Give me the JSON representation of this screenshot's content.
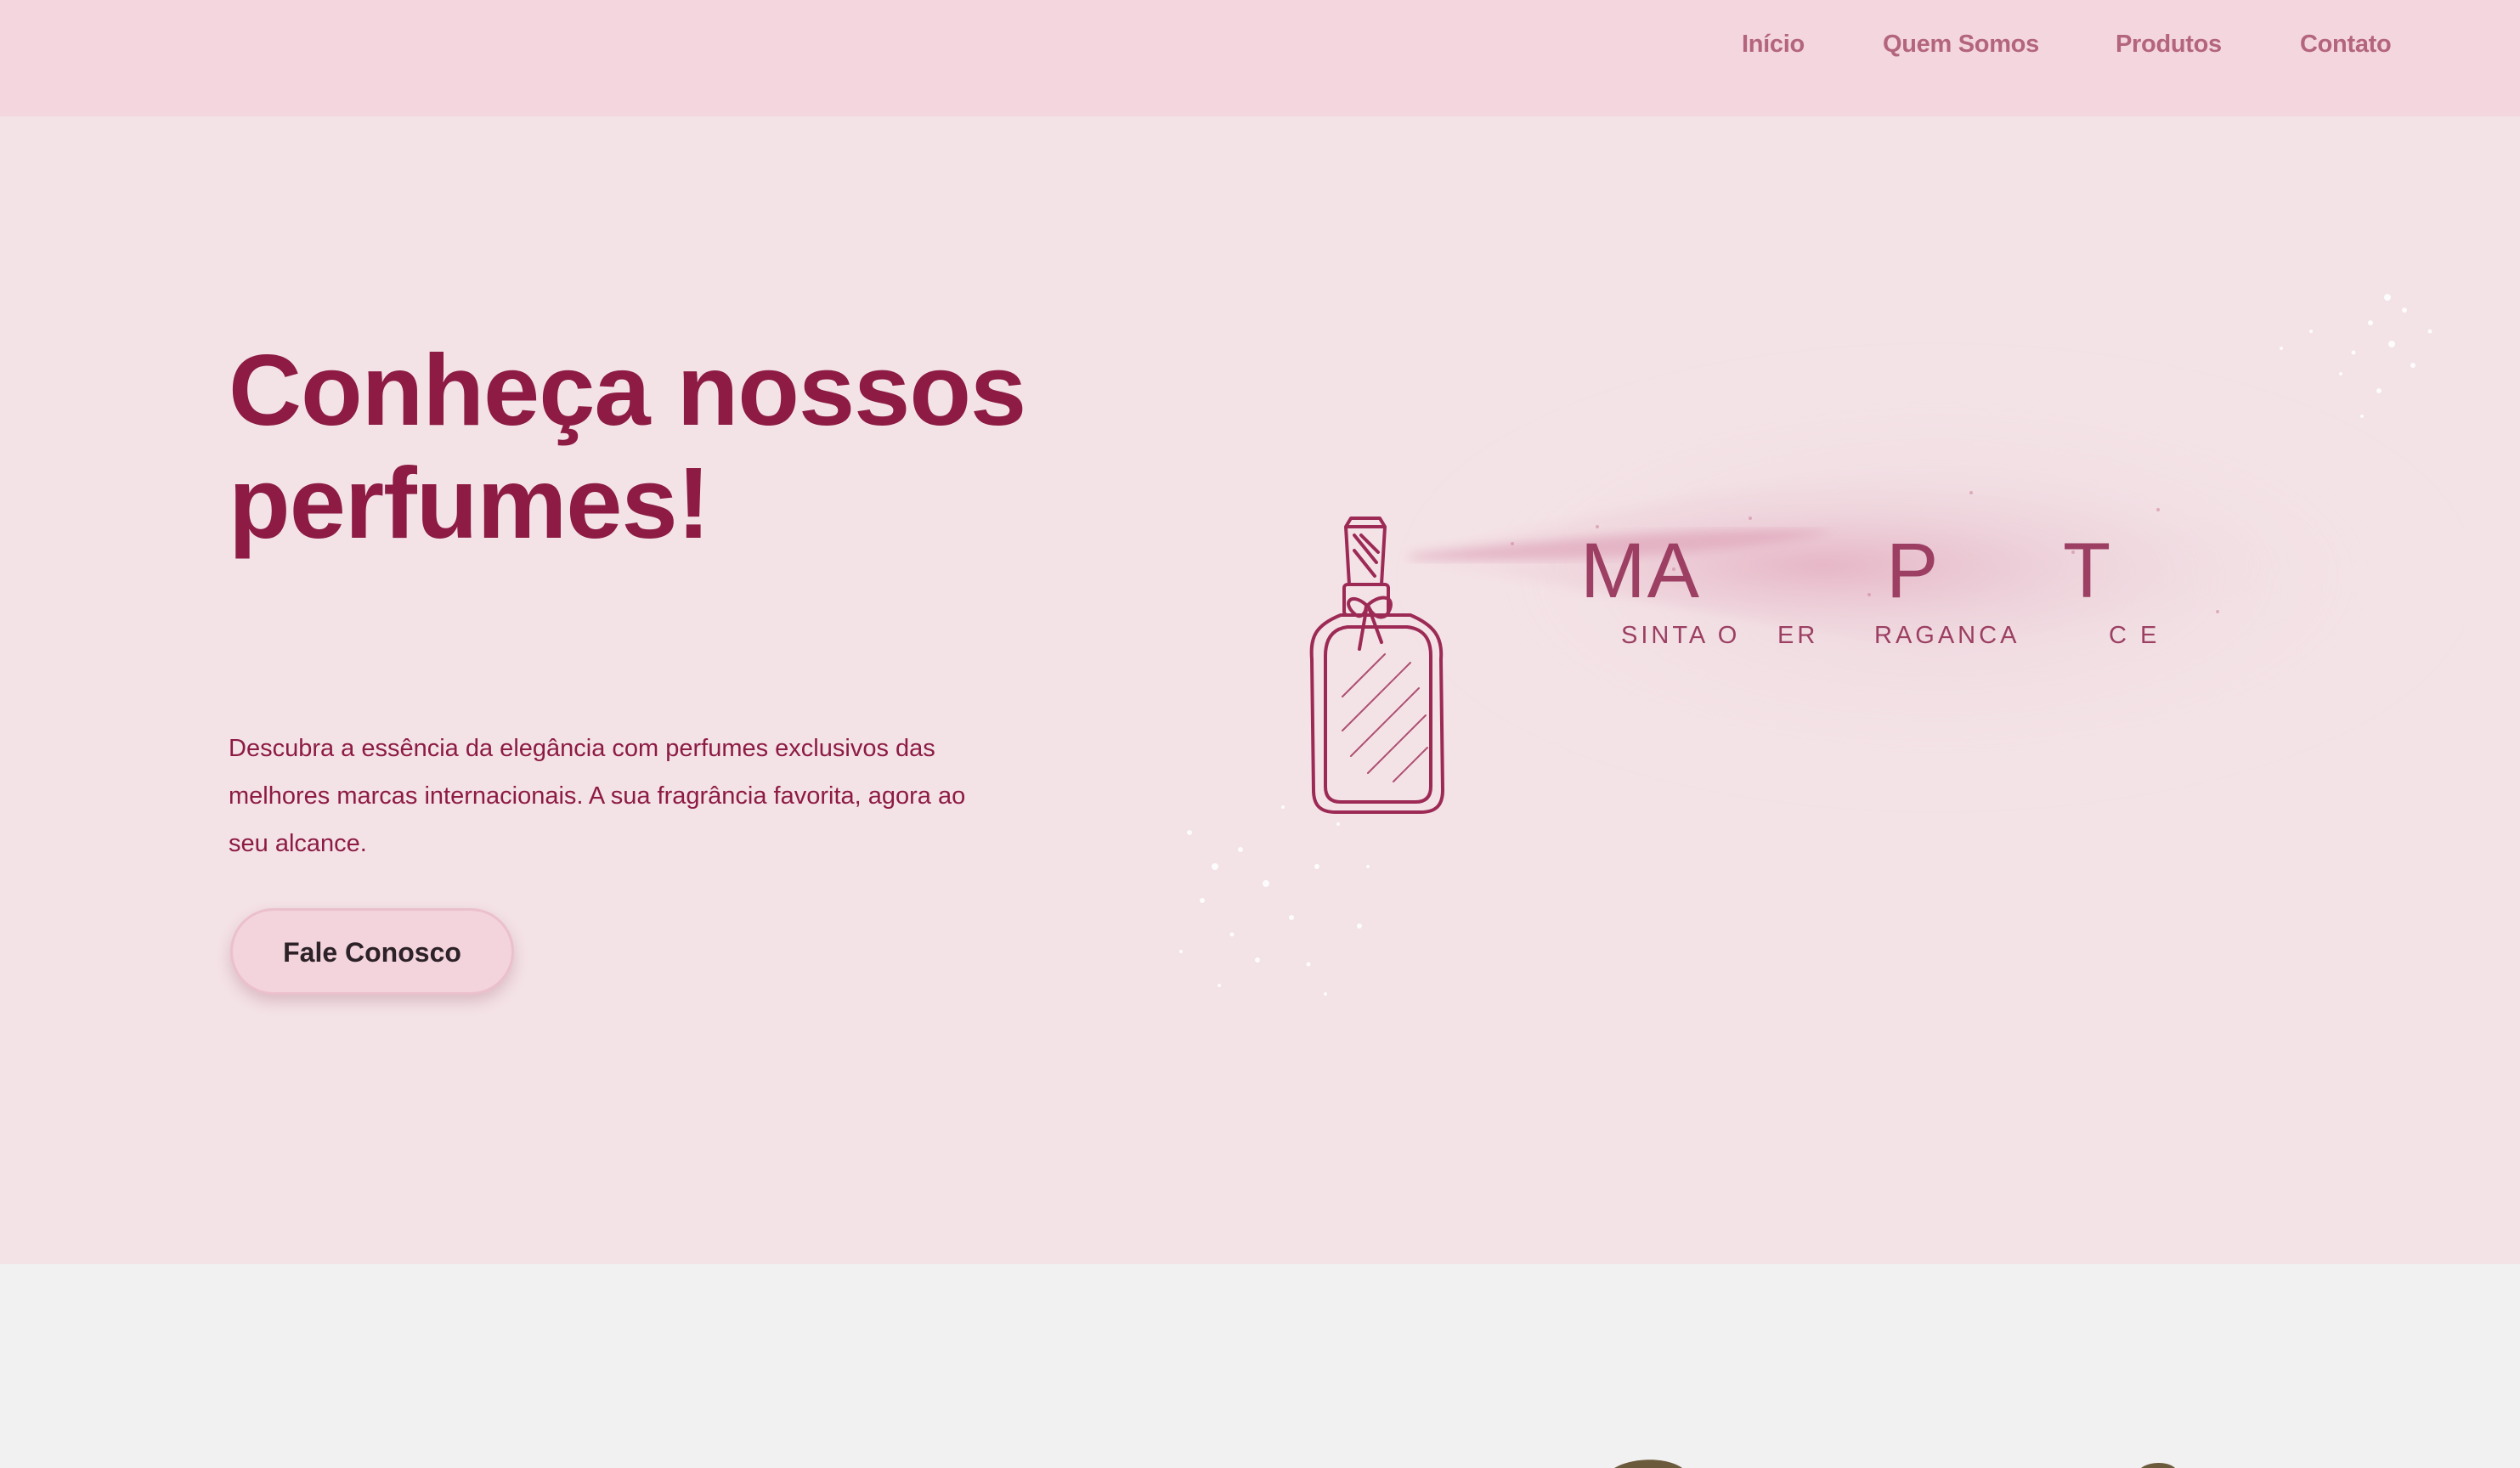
{
  "nav": {
    "items": [
      "Início",
      "Quem Somos",
      "Produtos",
      "Contato"
    ]
  },
  "hero": {
    "title": "Conheça nossos perfumes!",
    "description": "Descubra a essência da elegância com perfumes exclusivos das melhores marcas internacionais. A sua fragrância favorita, agora ao seu alcance.",
    "cta_label": "Fale Conosco"
  },
  "brand": {
    "visible_letters": [
      "MA",
      "P",
      "T"
    ],
    "tagline_fragments": [
      "SINTA O",
      "ER",
      "RAGANCA",
      "C  E"
    ]
  },
  "colors": {
    "nav_bg": "#f3d6de",
    "hero_bg": "#f3e2e6",
    "accent": "#8d1b44",
    "nav_text": "#b4657e",
    "section_bg": "#f0f1f0"
  },
  "icons": [
    "perfume-bottle-icon",
    "perfume-mist-illustration"
  ]
}
